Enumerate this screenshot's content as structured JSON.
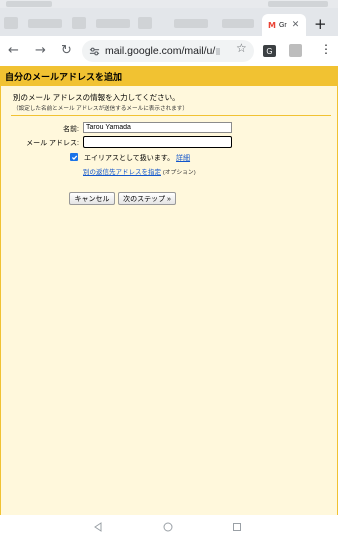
{
  "browser": {
    "active_tab_title": "Gr",
    "url": "mail.google.com/mail/u/",
    "translate_label": "G"
  },
  "dialog": {
    "title": "自分のメールアドレスを追加",
    "intro_title": "別のメール アドレスの情報を入力してください。",
    "intro_subtitle": "（設定した名前とメール アドレスが送信するメールに表示されます）",
    "name_label": "名前:",
    "name_value": "Tarou Yamada",
    "email_label": "メール アドレス:",
    "email_value": "",
    "alias_text": "エイリアスとして扱います。",
    "alias_checked": true,
    "details_link": "詳細",
    "reply_to_link": "別の返信先アドレスを指定",
    "optional_text": "(オプション)",
    "cancel_button": "キャンセル",
    "next_button": "次のステップ »"
  },
  "colors": {
    "header": "#f1c232",
    "panel": "#fff8dc",
    "link": "#1155cc",
    "checkbox": "#1a73e8"
  }
}
